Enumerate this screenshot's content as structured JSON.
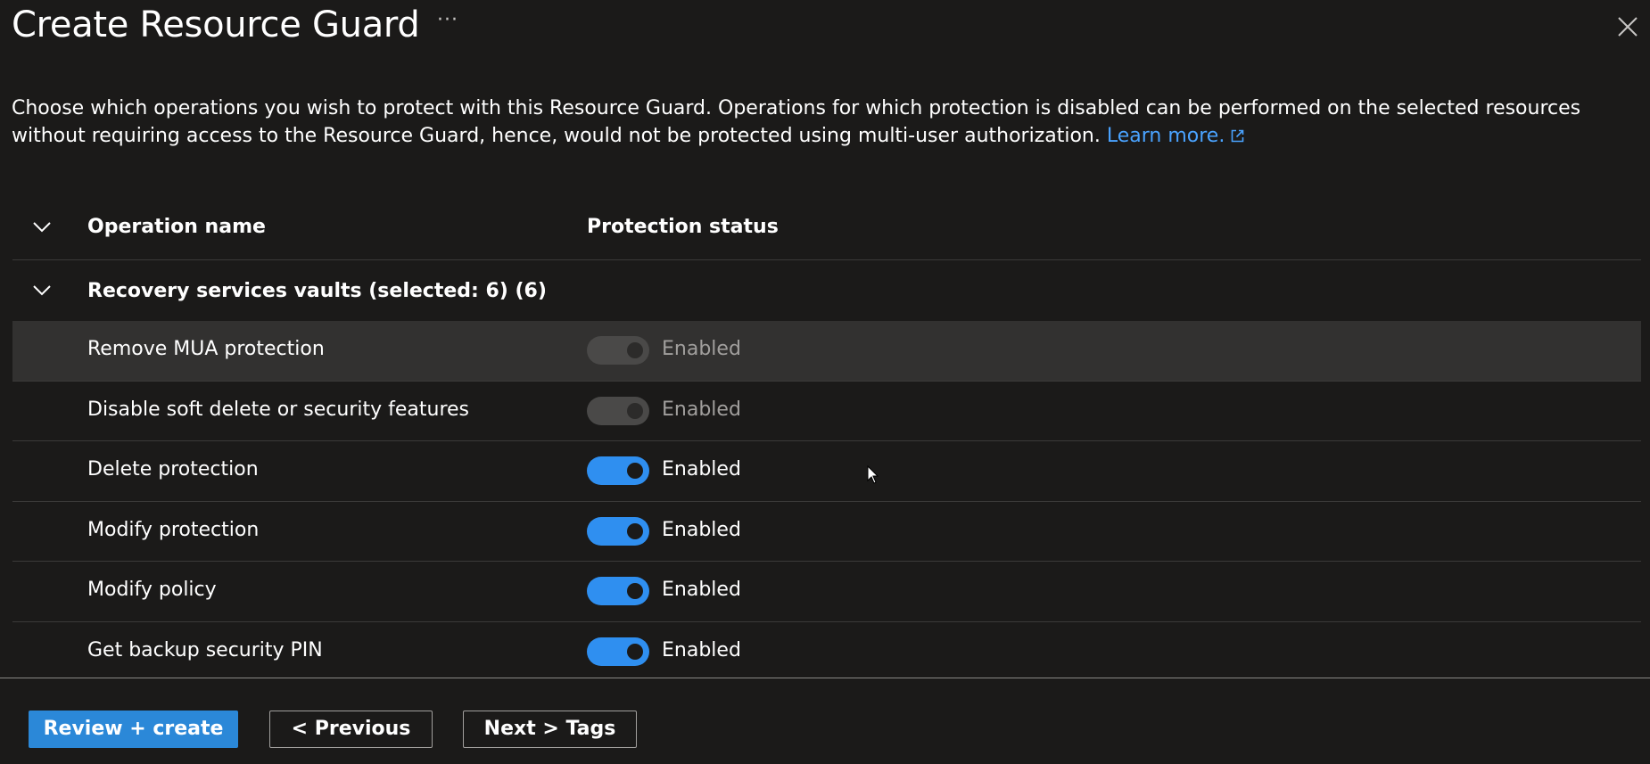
{
  "header": {
    "title": "Create Resource Guard",
    "more_label": "···"
  },
  "description": {
    "text": "Choose which operations you wish to protect with this Resource Guard. Operations for which protection is disabled can be performed on the selected resources without requiring access to the Resource Guard, hence, would not be protected using multi-user authorization.",
    "link_text": "Learn more."
  },
  "grid": {
    "columns": {
      "operation": "Operation name",
      "status": "Protection status"
    },
    "group": {
      "label": "Recovery services vaults (selected: 6) (6)"
    },
    "rows": [
      {
        "name": "Remove MUA protection",
        "status": "Enabled",
        "enabled": true,
        "locked": true
      },
      {
        "name": "Disable soft delete or security features",
        "status": "Enabled",
        "enabled": true,
        "locked": true
      },
      {
        "name": "Delete protection",
        "status": "Enabled",
        "enabled": true,
        "locked": false
      },
      {
        "name": "Modify protection",
        "status": "Enabled",
        "enabled": true,
        "locked": false
      },
      {
        "name": "Modify policy",
        "status": "Enabled",
        "enabled": true,
        "locked": false
      },
      {
        "name": "Get backup security PIN",
        "status": "Enabled",
        "enabled": true,
        "locked": false
      }
    ]
  },
  "footer": {
    "review_label": "Review + create",
    "previous_label": "< Previous",
    "next_label": "Next > Tags"
  },
  "colors": {
    "background": "#1b1a19",
    "accent": "#2b88d8",
    "toggle_on": "#2f8ff0",
    "link": "#4aa3ff"
  }
}
